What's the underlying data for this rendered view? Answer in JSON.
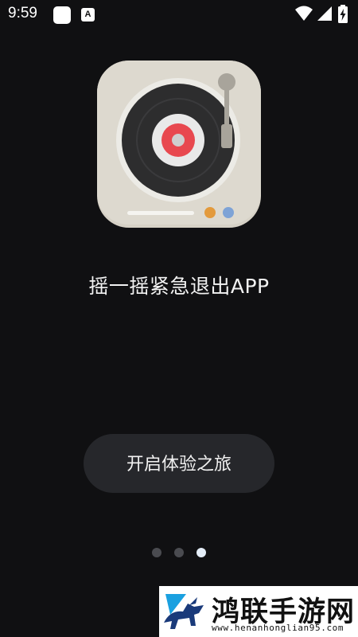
{
  "status_bar": {
    "time": "9:59",
    "notification_icons": [
      "app-notification-icon",
      "a-notification-icon"
    ],
    "notification_a_glyph": "A",
    "system_icons": [
      "wifi-icon",
      "signal-icon",
      "battery-charging-icon"
    ]
  },
  "onboarding": {
    "app_icon": "record-player-icon",
    "headline": "摇一摇紧急退出APP",
    "start_button_label": "开启体验之旅",
    "page_count": 3,
    "current_page": 3
  },
  "watermark": {
    "title": "鸿联手游网",
    "url": "www.henanhonglian95.com"
  },
  "colors": {
    "background": "#101012",
    "button": "#26272b",
    "dot_inactive": "#4a4b50",
    "dot_active": "#e4edf7",
    "record_red": "#e8484f",
    "knob_orange": "#e39a3c",
    "knob_blue": "#7ea3d6"
  }
}
